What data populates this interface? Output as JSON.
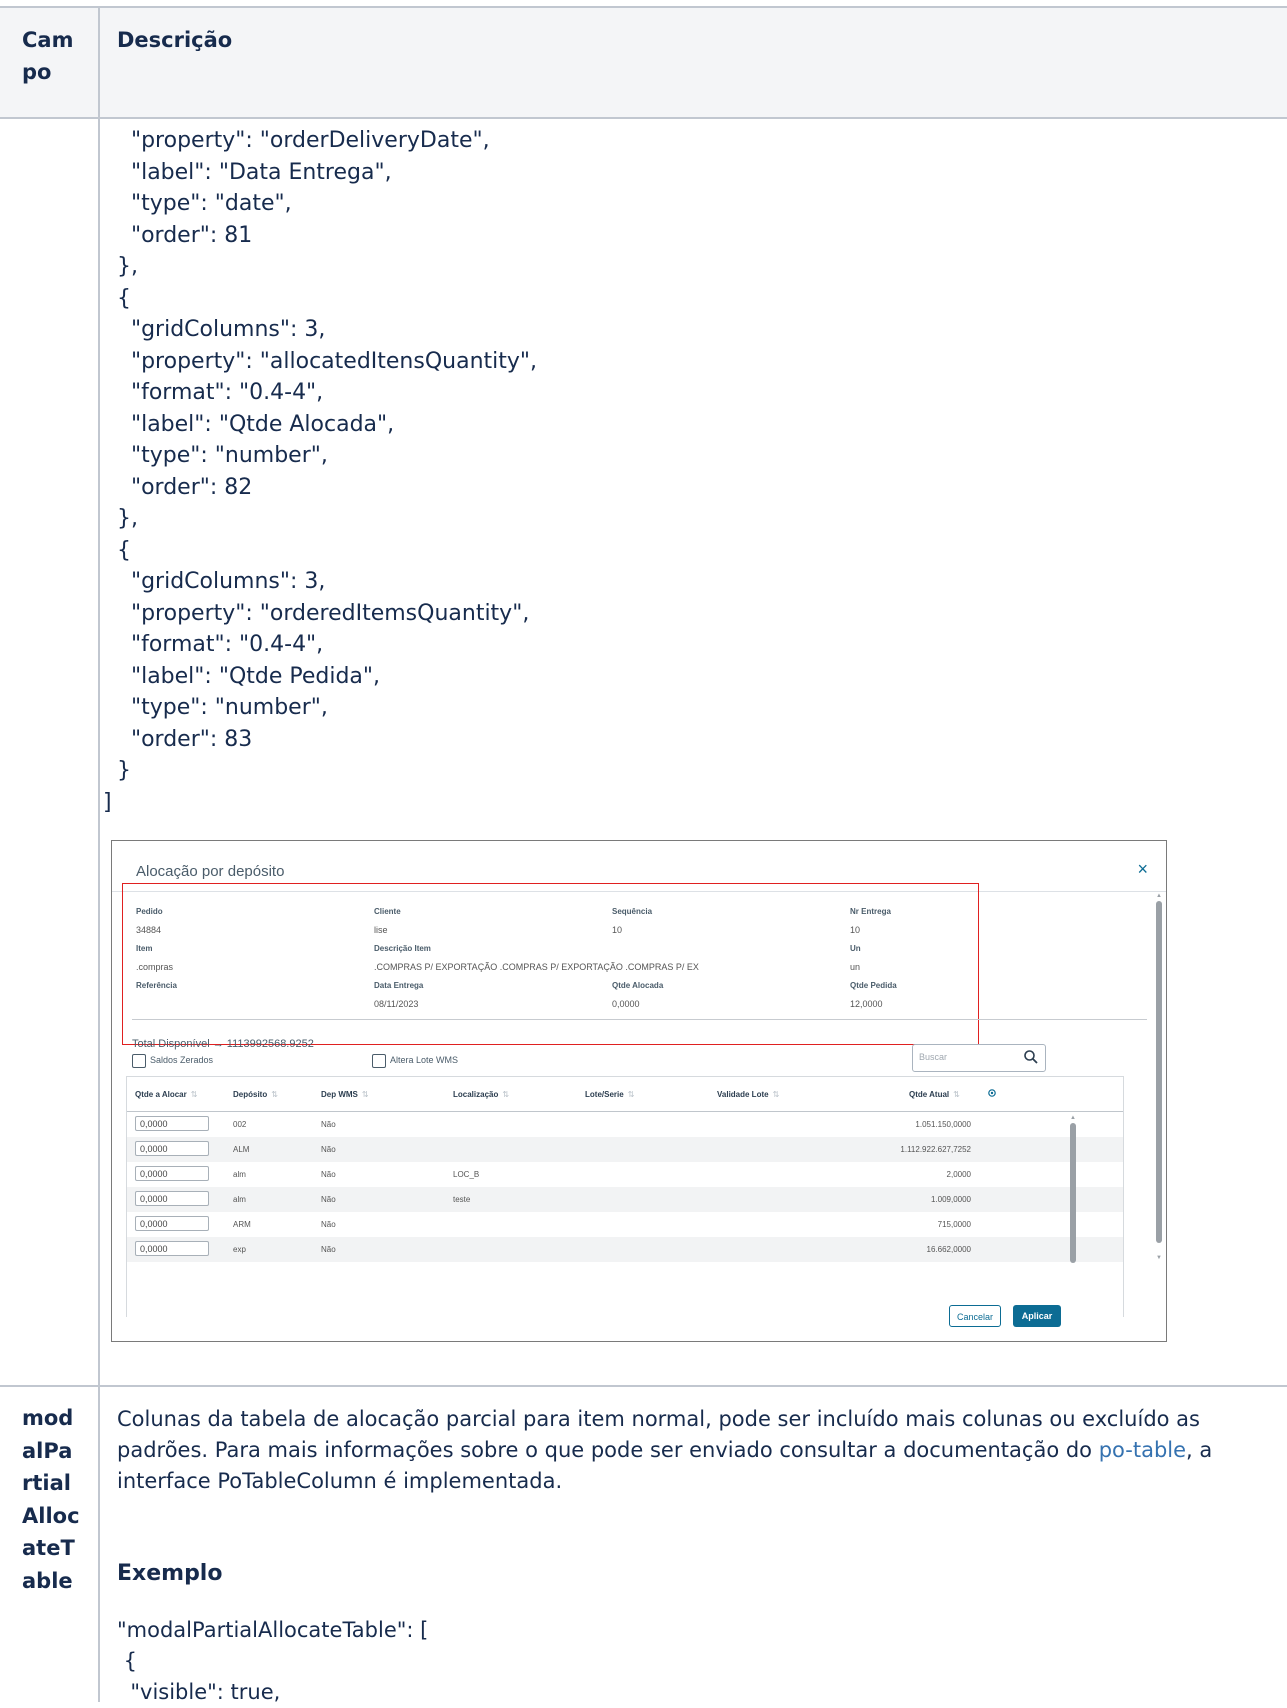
{
  "table": {
    "col_campo": "Cam\npo",
    "col_descricao": "Descrição"
  },
  "row1": {
    "code": "    \"property\": \"orderDeliveryDate\",\n    \"label\": \"Data Entrega\",\n    \"type\": \"date\",\n    \"order\": 81\n  },\n  {\n    \"gridColumns\": 3,\n    \"property\": \"allocatedItensQuantity\",\n    \"format\": \"0.4-4\",\n    \"label\": \"Qtde Alocada\",\n    \"type\": \"number\",\n    \"order\": 82\n  },\n  {\n    \"gridColumns\": 3,\n    \"property\": \"orderedItemsQuantity\",\n    \"format\": \"0.4-4\",\n    \"label\": \"Qtde Pedida\",\n    \"type\": \"number\",\n    \"order\": 83\n  }\n]"
  },
  "modal": {
    "title": "Alocação por depósito",
    "close": "×",
    "info": {
      "pedido_label": "Pedido",
      "pedido": "34884",
      "cliente_label": "Cliente",
      "cliente": "lise",
      "sequencia_label": "Sequência",
      "sequencia": "10",
      "nr_entrega_label": "Nr Entrega",
      "nr_entrega": "10",
      "item_label": "Item",
      "item": ".compras",
      "descricao_label": "Descrição Item",
      "descricao": ".COMPRAS P/ EXPORTAÇÃO .COMPRAS P/ EXPORTAÇÃO .COMPRAS P/ EX",
      "un_label": "Un",
      "un": "un",
      "referencia_label": "Referência",
      "data_entrega_label": "Data Entrega",
      "data_entrega": "08/11/2023",
      "qtde_alocada_label": "Qtde Alocada",
      "qtde_alocada": "0,0000",
      "qtde_pedida_label": "Qtde Pedida",
      "qtde_pedida": "12,0000"
    },
    "total": "Total Disponível → 1113992568.9252",
    "saldos_zerados": "Saldos Zerados",
    "altera_lote": "Altera Lote WMS",
    "search_placeholder": "Buscar",
    "columns": [
      "Qtde a Alocar",
      "Depósito",
      "Dep WMS",
      "Localização",
      "Lote/Serie",
      "Validade Lote",
      "Qtde Atual"
    ],
    "rows": [
      {
        "qtde": "0,0000",
        "deposito": "002",
        "dep_wms": "Não",
        "localizacao": "",
        "atual": "1.051.150,0000"
      },
      {
        "qtde": "0,0000",
        "deposito": "ALM",
        "dep_wms": "Não",
        "localizacao": "",
        "atual": "1.112.922.627,7252"
      },
      {
        "qtde": "0,0000",
        "deposito": "alm",
        "dep_wms": "Não",
        "localizacao": "LOC_B",
        "atual": "2,0000"
      },
      {
        "qtde": "0,0000",
        "deposito": "alm",
        "dep_wms": "Não",
        "localizacao": "teste",
        "atual": "1.009,0000"
      },
      {
        "qtde": "0,0000",
        "deposito": "ARM",
        "dep_wms": "Não",
        "localizacao": "",
        "atual": "715,0000"
      },
      {
        "qtde": "0,0000",
        "deposito": "exp",
        "dep_wms": "Não",
        "localizacao": "",
        "atual": "16.662,0000"
      }
    ],
    "cancel": "Cancelar",
    "apply": "Aplicar"
  },
  "row2": {
    "campo": "mod\nalPa\nrtial\nAlloc\nateT\nable",
    "desc_before": "Colunas da tabela de alocação parcial para item normal, pode ser incluído mais colunas ou excluído as padrões. Para mais informações sobre o que pode ser enviado consultar a documentação do ",
    "link": "po-table",
    "desc_after": ", a interface PoTableColumn é implementada.",
    "exemplo": "Exemplo",
    "code": "\"modalPartialAllocateTable\": [\n {\n  \"visible\": true,"
  }
}
